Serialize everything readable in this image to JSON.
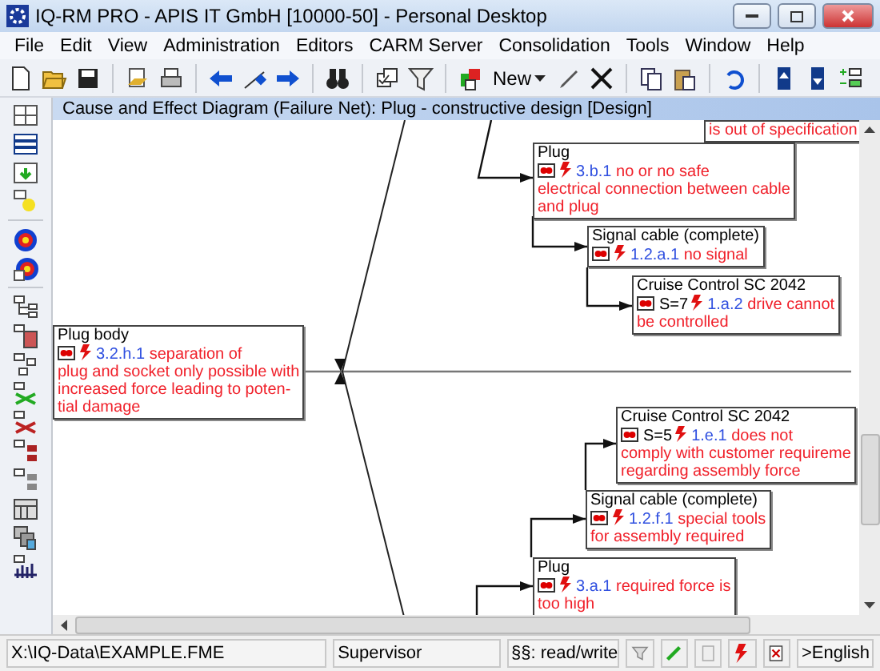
{
  "window": {
    "title": "IQ-RM PRO - APIS IT GmbH [10000-50] - Personal Desktop"
  },
  "menu": [
    "File",
    "Edit",
    "View",
    "Administration",
    "Editors",
    "CARM Server",
    "Consolidation",
    "Tools",
    "Window",
    "Help"
  ],
  "toolbar": {
    "new_label": "New"
  },
  "document": {
    "title": "Cause and Effect Diagram (Failure Net): Plug - constructive design [Design]"
  },
  "nodes": [
    {
      "kind": "partial",
      "text": "is out of specification"
    },
    {
      "kind": "failure",
      "title": "Plug",
      "code": "3.b.1",
      "text": "no or no safe\nelectrical connection between cable\nand plug"
    },
    {
      "kind": "failure",
      "title": "Signal cable (complete)",
      "code": "1.2.a.1",
      "text": "no signal"
    },
    {
      "kind": "failure",
      "title": "Cruise Control SC 2042",
      "severity": "S=7",
      "code": "1.a.2",
      "text": "drive cannot\nbe controlled"
    },
    {
      "kind": "failure",
      "title": "Plug body",
      "code": "3.2.h.1",
      "text": "separation of\nplug and socket only possible with\nincreased force leading to poten-\ntial damage"
    },
    {
      "kind": "failure",
      "title": "Cruise Control SC 2042",
      "severity": "S=5",
      "code": "1.e.1",
      "text": "does not\ncomply with customer requireme\nregarding assembly force"
    },
    {
      "kind": "failure",
      "title": "Signal cable (complete)",
      "code": "1.2.f.1",
      "text": "special tools\nfor assembly required"
    },
    {
      "kind": "failure",
      "title": "Plug",
      "code": "3.a.1",
      "text": "required force is\ntoo high"
    }
  ],
  "status_bar": {
    "path": "X:\\IQ-Data\\EXAMPLE.FME",
    "user": "Supervisor",
    "rights": "§§: read/write",
    "language": ">English"
  }
}
